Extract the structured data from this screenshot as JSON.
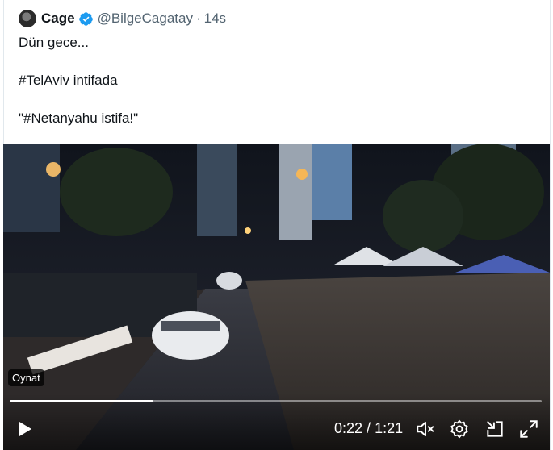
{
  "tweet": {
    "author_name": "Cage",
    "handle": "@BilgeCagatay",
    "separator": "·",
    "time": "14s",
    "lines": [
      "Dün gece...",
      "#TelAviv intifada",
      "\"#Netanyahu istifa!\""
    ]
  },
  "video": {
    "badge": "Oynat",
    "current_time": "0:22",
    "duration": "1:21",
    "time_separator": " / ",
    "progress_fraction": 0.27,
    "icons": [
      "play-icon",
      "mute-icon",
      "settings-icon",
      "pip-icon",
      "fullscreen-icon"
    ]
  },
  "colors": {
    "verified": "#1d9bf0",
    "text": "#0f1419",
    "muted": "#536471"
  }
}
